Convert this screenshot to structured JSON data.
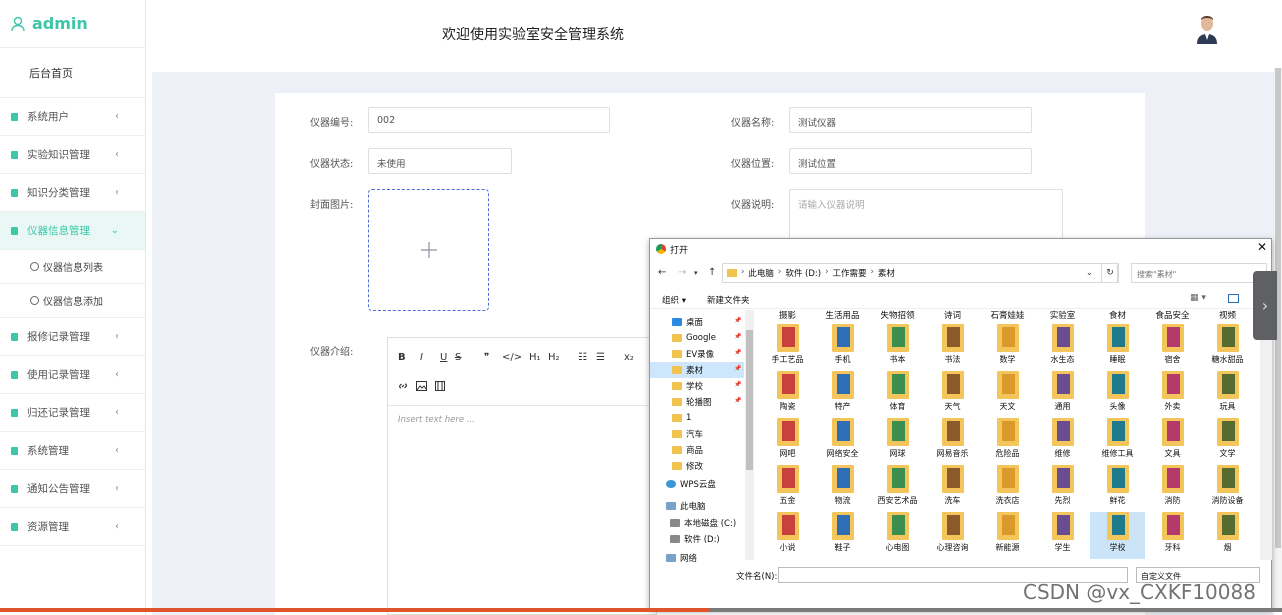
{
  "brand": {
    "title": "admin"
  },
  "header": {
    "title": "欢迎使用实验室安全管理系统"
  },
  "sidebar": {
    "home": "后台首页",
    "items": [
      {
        "label": "系统用户"
      },
      {
        "label": "实验知识管理"
      },
      {
        "label": "知识分类管理"
      },
      {
        "label": "仪器信息管理"
      },
      {
        "label": "报修记录管理"
      },
      {
        "label": "使用记录管理"
      },
      {
        "label": "归还记录管理"
      },
      {
        "label": "系统管理"
      },
      {
        "label": "通知公告管理"
      },
      {
        "label": "资源管理"
      }
    ],
    "sub_items": [
      {
        "label": "仪器信息列表"
      },
      {
        "label": "仪器信息添加"
      }
    ]
  },
  "form": {
    "code_label": "仪器编号:",
    "code_value": "002",
    "name_label": "仪器名称:",
    "name_value": "测试仪器",
    "status_label": "仪器状态:",
    "status_value": "未使用",
    "location_label": "仪器位置:",
    "location_value": "测试位置",
    "cover_label": "封面图片:",
    "desc_label": "仪器说明:",
    "desc_placeholder": "请输入仪器说明",
    "intro_label": "仪器介绍:"
  },
  "editor": {
    "toolbar": [
      "B",
      "I",
      "U",
      "S",
      "❞",
      "</>",
      "H₁",
      "H₂",
      "☷",
      "☰",
      "x₂"
    ],
    "placeholder": "Insert text here ..."
  },
  "dialog": {
    "title": "打开",
    "path": [
      "此电脑",
      "软件 (D:)",
      "工作需要",
      "素材"
    ],
    "search_placeholder": "搜索\"素材\"",
    "organize": "组织 ▾",
    "new_folder": "新建文件夹",
    "tree": [
      {
        "label": "桌面",
        "icon": "blue",
        "pin": true
      },
      {
        "label": "Google",
        "icon": "folder",
        "pin": true
      },
      {
        "label": "EV录像",
        "icon": "folder",
        "pin": true
      },
      {
        "label": "素材",
        "icon": "folder",
        "pin": true,
        "selected": true
      },
      {
        "label": "学校",
        "icon": "folder",
        "pin": true
      },
      {
        "label": "轮播图",
        "icon": "folder",
        "pin": true
      },
      {
        "label": "1",
        "icon": "folder"
      },
      {
        "label": "汽车",
        "icon": "folder"
      },
      {
        "label": "商品",
        "icon": "folder"
      },
      {
        "label": "修改",
        "icon": "folder"
      },
      {
        "label": "WPS云盘",
        "icon": "cloud"
      },
      {
        "label": "此电脑",
        "icon": "pc"
      },
      {
        "label": "本地磁盘 (C:)",
        "icon": "drive"
      },
      {
        "label": "软件 (D:)",
        "icon": "drive"
      },
      {
        "label": "网络",
        "icon": "pc"
      }
    ],
    "top_row": [
      "摄影",
      "生活用品",
      "失物招领",
      "诗词",
      "石膏娃娃",
      "实验室",
      "食材",
      "食品安全",
      "视频"
    ],
    "grid": [
      [
        "手工艺品",
        "手机",
        "书本",
        "书法",
        "数学",
        "水生态",
        "睡眠",
        "宿舍",
        "糖水甜品"
      ],
      [
        "陶瓷",
        "特产",
        "体育",
        "天气",
        "天文",
        "通用",
        "头像",
        "外卖",
        "玩具"
      ],
      [
        "网吧",
        "网络安全",
        "网球",
        "网易音乐",
        "危险品",
        "维修",
        "维修工具",
        "文具",
        "文学"
      ],
      [
        "五金",
        "物流",
        "西安艺术品",
        "洗车",
        "洗衣店",
        "先烈",
        "鲜花",
        "消防",
        "消防设备"
      ],
      [
        "小说",
        "鞋子",
        "心电图",
        "心理咨询",
        "新能源",
        "学生",
        "学校",
        "牙科",
        "烟"
      ]
    ],
    "selected_item": "学校",
    "filename_label": "文件名(N):",
    "filetype": "自定义文件"
  },
  "watermark": "CSDN @vx_CXKF10088",
  "colors": {
    "accent": "#3ec6a8",
    "main_bg": "#eef0f8",
    "uploader_border": "#4b6ed8"
  }
}
